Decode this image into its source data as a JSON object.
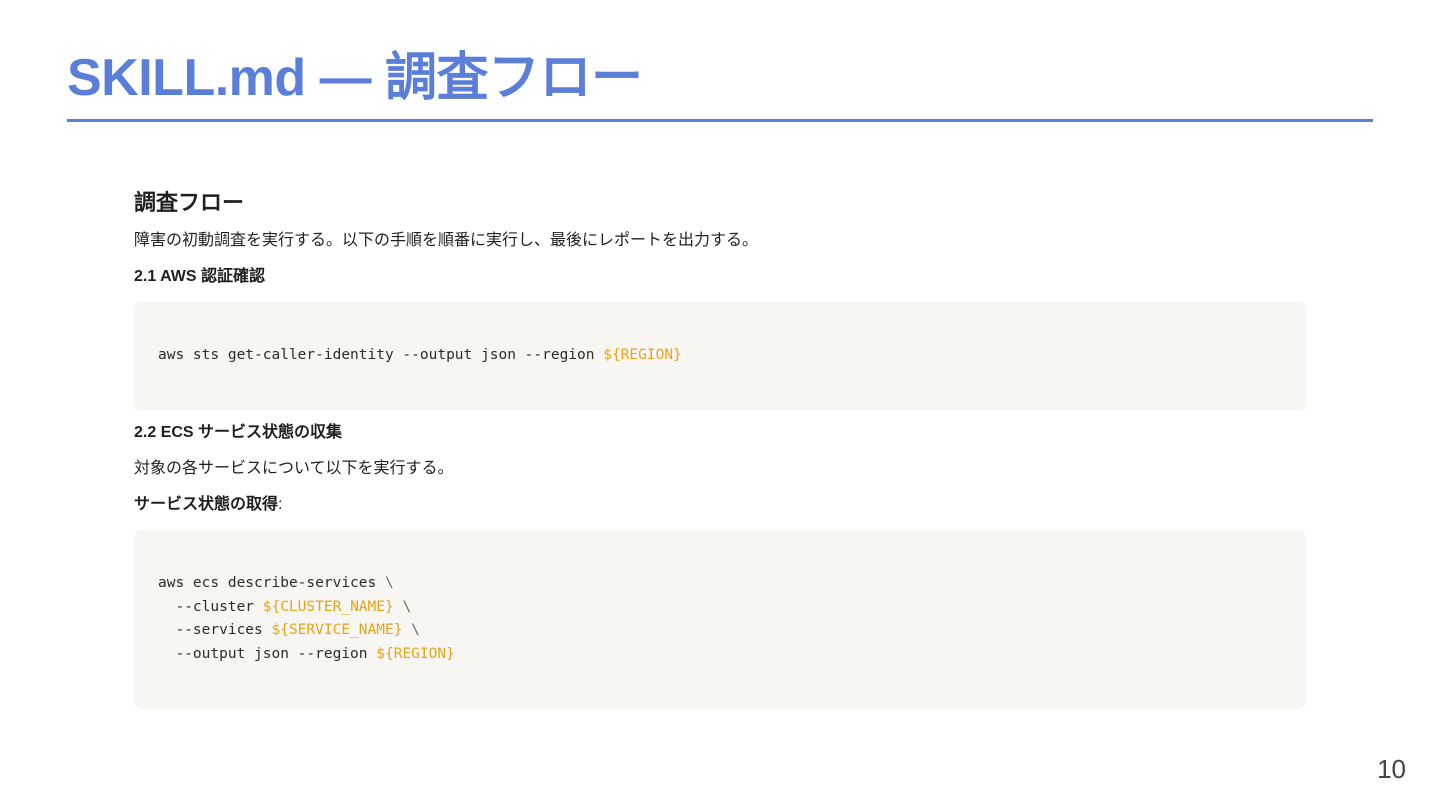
{
  "slide": {
    "title": "SKILL.md — 調査フロー",
    "page_number": "10"
  },
  "content": {
    "heading": "調査フロー",
    "intro": "障害の初動調査を実行する。以下の手順を順番に実行し、最後にレポートを出力する。",
    "section1": {
      "heading": "2.1 AWS 認証確認",
      "code": {
        "command": "aws sts get-caller-identity --output json --region ",
        "var": "${REGION}"
      }
    },
    "section2": {
      "heading": "2.2 ECS サービス状態の収集",
      "description": "対象の各サービスについて以下を実行する。",
      "label": "サービス状態の取得",
      "label_suffix": ":",
      "code": {
        "line1": "aws ecs describe-services ",
        "line1_bs": "\\",
        "line2_prefix": "  --cluster ",
        "line2_var": "${CLUSTER_NAME}",
        "line2_bs": " \\",
        "line3_prefix": "  --services ",
        "line3_var": "${SERVICE_NAME}",
        "line3_bs": " \\",
        "line4_prefix": "  --output json --region ",
        "line4_var": "${REGION}"
      }
    }
  },
  "colors": {
    "accent": "#5b7fd9",
    "code_bg": "#f7f6f3",
    "code_var": "#e8a317"
  }
}
